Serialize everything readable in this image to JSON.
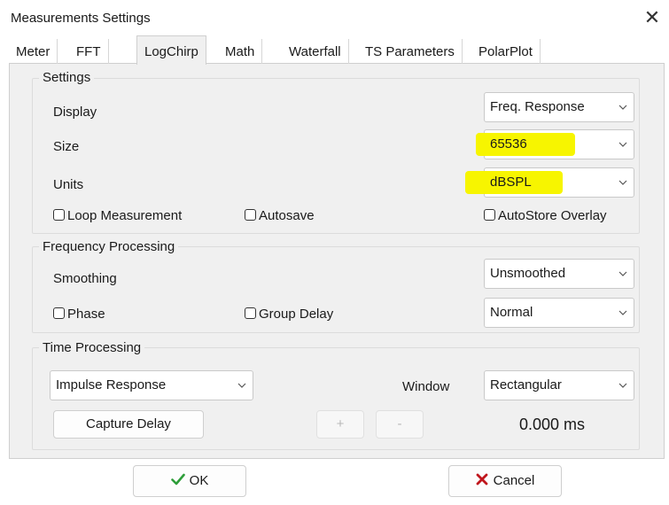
{
  "window": {
    "title": "Measurements Settings",
    "close_glyph": "✕"
  },
  "tabs": [
    {
      "label": "Meter"
    },
    {
      "label": "FFT"
    },
    {
      "label": "LogChirp"
    },
    {
      "label": "Math"
    },
    {
      "label": "Waterfall"
    },
    {
      "label": "TS Parameters"
    },
    {
      "label": "PolarPlot"
    }
  ],
  "settings": {
    "group_title": "Settings",
    "display": {
      "label": "Display",
      "value": "Freq. Response"
    },
    "size": {
      "label": "Size",
      "value": "65536"
    },
    "units": {
      "label": "Units",
      "value": "dBSPL"
    },
    "loop_measurement": {
      "label": "Loop Measurement",
      "checked": false
    },
    "autosave": {
      "label": "Autosave",
      "checked": false
    },
    "autostore_overlay": {
      "label": "AutoStore Overlay",
      "checked": false
    }
  },
  "frequency_processing": {
    "group_title": "Frequency Processing",
    "smoothing": {
      "label": "Smoothing",
      "value": "Unsmoothed"
    },
    "phase": {
      "label": "Phase",
      "checked": false
    },
    "group_delay": {
      "label": "Group Delay",
      "checked": false
    },
    "mode": {
      "value": "Normal"
    }
  },
  "time_processing": {
    "group_title": "Time Processing",
    "response": {
      "value": "Impulse Response"
    },
    "window": {
      "label": "Window",
      "value": "Rectangular"
    },
    "capture_delay": {
      "label": "Capture Delay"
    },
    "plus": {
      "label": "+"
    },
    "minus": {
      "label": "-"
    },
    "delay_value": "0.000 ms"
  },
  "footer": {
    "ok": {
      "label": "OK",
      "icon": "checkmark-icon",
      "icon_color": "#2e9e3a"
    },
    "cancel": {
      "label": "Cancel",
      "icon": "x-icon",
      "icon_color": "#c0161d"
    }
  },
  "colors": {
    "highlight": "#f7f500",
    "panel_bg": "#f0f0f0",
    "border": "#cfcfcf"
  }
}
